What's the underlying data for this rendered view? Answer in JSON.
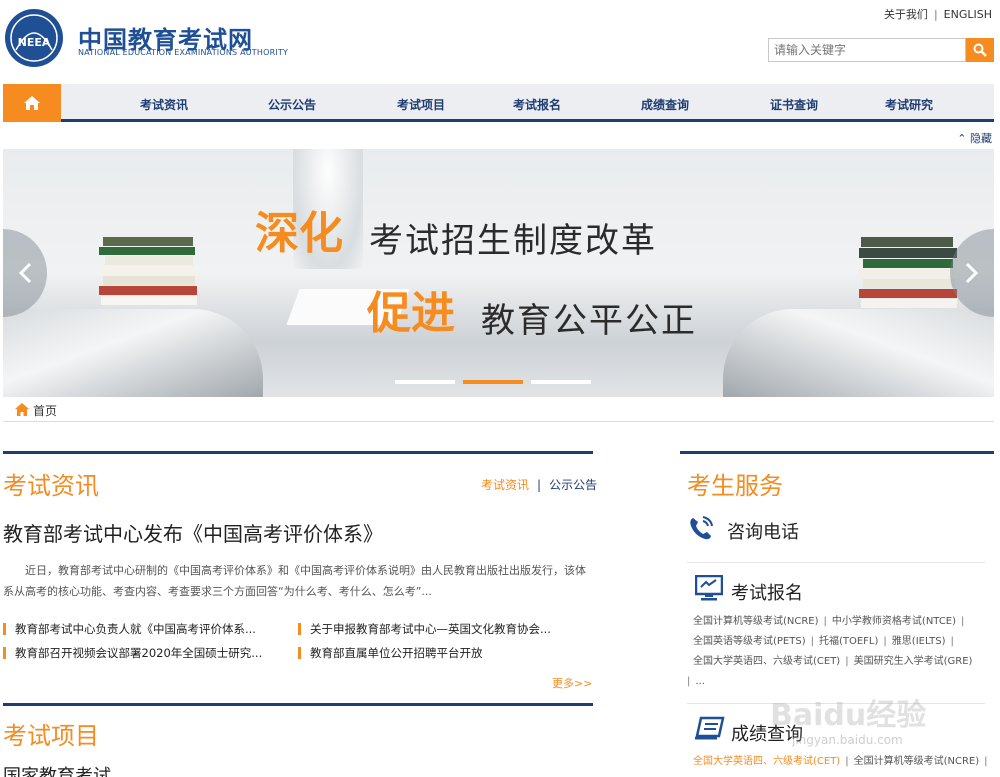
{
  "header": {
    "logo_text": "NEEA",
    "logo_cn": "中国教育考试网",
    "logo_en": "NATIONAL EDUCATION EXAMINATIONS AUTHORITY",
    "about": "关于我们",
    "english": "ENGLISH",
    "search_placeholder": "请输入关键字"
  },
  "nav": {
    "items": [
      "考试资讯",
      "公示公告",
      "考试项目",
      "考试报名",
      "成绩查询",
      "证书查询",
      "考试研究"
    ],
    "hide": "隐藏"
  },
  "banner": {
    "highlight1": "深化",
    "text1": "考试招生制度改革",
    "highlight2": "促进",
    "text2": "教育公平公正",
    "active_slide": 2,
    "slide_count": 3
  },
  "breadcrumb": {
    "home": "首页"
  },
  "news": {
    "title": "考试资讯",
    "tab_active": "考试资讯",
    "tab_other": "公示公告",
    "headline": "教育部考试中心发布《中国高考评价体系》",
    "summary": "近日，教育部考试中心研制的《中国高考评价体系》和《中国高考评价体系说明》由人民教育出版社出版发行，该体系从高考的核心功能、考查内容、考查要求三个方面回答“为什么考、考什么、怎么考”...",
    "items": [
      "教育部考试中心负责人就《中国高考评价体系...",
      "关于申报教育部考试中心—英国文化教育协会...",
      "教育部召开视频会议部署2020年全国硕士研究...",
      "教育部直属单位公开招聘平台开放"
    ],
    "more": "更多>>"
  },
  "projects": {
    "title": "考试项目",
    "sub": "国家教育考试"
  },
  "service": {
    "title": "考生服务",
    "consult": "咨询电话",
    "register": "考试报名",
    "register_links": [
      "全国计算机等级考试(NCRE)",
      "中小学教师资格考试(NTCE)",
      "全国英语等级考试(PETS)",
      "托福(TOEFL)",
      "雅思(IELTS)",
      "全国大学英语四、六级考试(CET)",
      "美国研究生入学考试(GRE)",
      "..."
    ],
    "score": "成绩查询",
    "score_links": [
      "全国大学英语四、六级考试(CET)",
      "全国计算机等级考试(NCRE)"
    ]
  },
  "watermark": {
    "main": "Baidu经验",
    "sub": "jingyan.baidu.com"
  },
  "colors": {
    "accent": "#f68b1f",
    "navy": "#1f3d72"
  }
}
